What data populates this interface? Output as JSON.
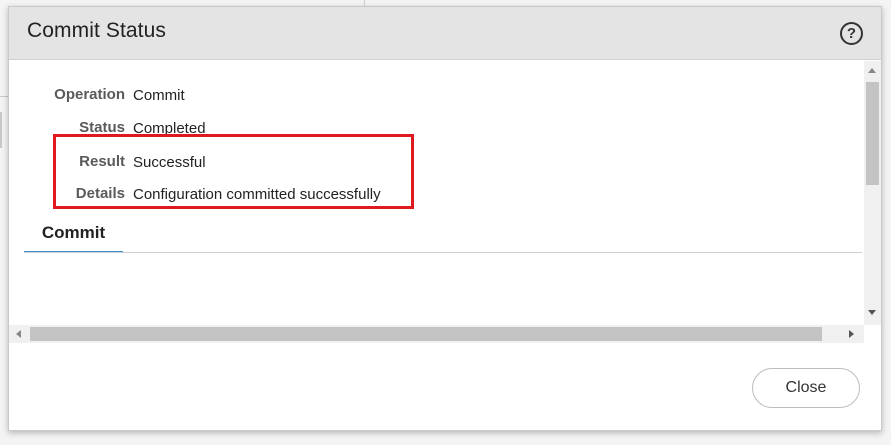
{
  "dialog": {
    "title": "Commit Status",
    "help_icon": "question-circle-icon",
    "help_glyph": "?"
  },
  "fields": [
    {
      "label": "Operation",
      "value": "Commit"
    },
    {
      "label": "Status",
      "value": "Completed"
    },
    {
      "label": "Result",
      "value": "Successful"
    },
    {
      "label": "Details",
      "value": "Configuration committed successfully"
    }
  ],
  "tabs": [
    {
      "label": "Commit",
      "active": true
    }
  ],
  "footer": {
    "close_label": "Close"
  },
  "colors": {
    "highlight": "#e0191f",
    "tab_accent": "#3a8fd1",
    "header_bg": "#e4e4e4"
  }
}
